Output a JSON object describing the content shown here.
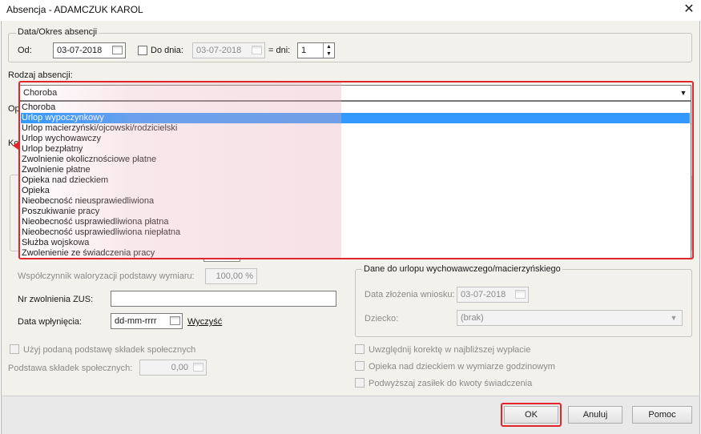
{
  "window": {
    "title": "Absencja - ADAMCZUK KAROL",
    "close_glyph": "✕"
  },
  "period": {
    "legend": "Data/Okres absencji",
    "from_label": "Od:",
    "from_value": "03-07-2018",
    "to_label": "Do dnia:",
    "to_value": "03-07-2018",
    "days_label": "= dni:",
    "days_value": "1"
  },
  "absence_type": {
    "label": "Rodzaj absencji:",
    "selected": "Choroba",
    "options": [
      "Choroba",
      "Urlop wypoczynkowy",
      "Urlop macierzyński/ojcowski/rodzicielski",
      "Urlop wychowawczy",
      "Urlop bezpłatny",
      "Zwolnienie okolicznościowe płatne",
      "Zwolnienie płatne",
      "Opieka nad dzieckiem",
      "Opieka",
      "Nieobecność nieusprawiedliwiona",
      "Poszukiwanie pracy",
      "Nieobecność usprawiedliwiona płatna",
      "Nieobecność usprawiedliwiona niepłatna",
      "Służba wojskowa",
      "Zwolenienie ze świadczenia pracy"
    ],
    "highlighted_index": 1
  },
  "hidden_labels": {
    "op": "Op",
    "ko": "Ko"
  },
  "left": {
    "valorization_label": "Współczynnik waloryzacji podstawy wymiaru:",
    "valorization_value": "100,00 %",
    "zus_label": "Nr zwolnienia ZUS:",
    "zus_value": "",
    "receipt_label": "Data wpłynięcia:",
    "receipt_value": "dd-mm-rrrr",
    "clear_link": "Wyczyść"
  },
  "right": {
    "legend": "Dane do urlopu wychowawczego/macierzyńskiego",
    "request_label": "Data złożenia wniosku:",
    "request_value": "03-07-2018",
    "child_label": "Dziecko:",
    "child_value": "(brak)"
  },
  "checkboxes": {
    "use_base": "Użyj podaną podstawę składek społecznych",
    "base_label": "Podstawa składek społecznych:",
    "base_value": "0,00",
    "next_payroll": "Uwzględnij korektę w najbliższej wypłacie",
    "hourly_care": "Opieka nad dzieckiem w wymiarze godzinowym",
    "raise_allowance": "Podwyższaj zasiłek do kwoty świadczenia"
  },
  "buttons": {
    "ok": "OK",
    "cancel": "Anuluj",
    "help": "Pomoc"
  },
  "colors": {
    "highlight": "#3399ff",
    "annotation_red": "#e0262a",
    "dialog_bg": "#f3f1ec"
  }
}
